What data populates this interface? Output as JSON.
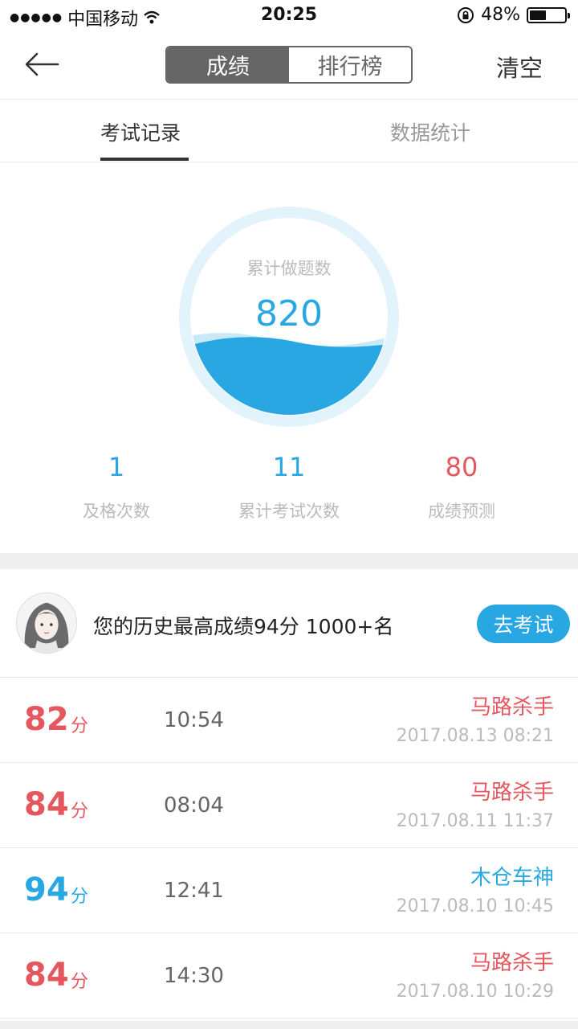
{
  "status_bar": {
    "signal_dots": "●●●●●",
    "carrier": "中国移动",
    "wifi_icon": "wifi-icon",
    "time": "20:25",
    "lock_icon": "rotation-lock-icon",
    "battery_percent": "48%",
    "battery_level": 0.48
  },
  "nav": {
    "back_icon": "arrow-left-icon",
    "segments": [
      "成绩",
      "排行榜"
    ],
    "active_segment": 0,
    "clear_label": "清空"
  },
  "tabs": {
    "items": [
      "考试记录",
      "数据统计"
    ],
    "active": 0
  },
  "gauge": {
    "label": "累计做题数",
    "value": "820"
  },
  "stats": [
    {
      "value": "1",
      "label": "及格次数",
      "color": "#29a7e3"
    },
    {
      "value": "11",
      "label": "累计考试次数",
      "color": "#29a7e3"
    },
    {
      "value": "80",
      "label": "成绩预测",
      "color": "#e5575f"
    }
  ],
  "best": {
    "avatar": "user-avatar",
    "text": "您的历史最高成绩94分 1000+名",
    "button_label": "去考试"
  },
  "records": [
    {
      "score": "82",
      "unit": "分",
      "duration": "10:54",
      "title": "马路杀手",
      "date": "2017.08.13 08:21",
      "color": "#e5575f"
    },
    {
      "score": "84",
      "unit": "分",
      "duration": "08:04",
      "title": "马路杀手",
      "date": "2017.08.11 11:37",
      "color": "#e5575f"
    },
    {
      "score": "94",
      "unit": "分",
      "duration": "12:41",
      "title": "木仓车神",
      "date": "2017.08.10 10:45",
      "color": "#29a7e3"
    },
    {
      "score": "84",
      "unit": "分",
      "duration": "14:30",
      "title": "马路杀手",
      "date": "2017.08.10 10:29",
      "color": "#e5575f"
    }
  ],
  "colors": {
    "accent_blue": "#29a7e3",
    "accent_red": "#e5575f",
    "wave_light": "#c9e9f8",
    "ring": "#e3f3fc"
  }
}
